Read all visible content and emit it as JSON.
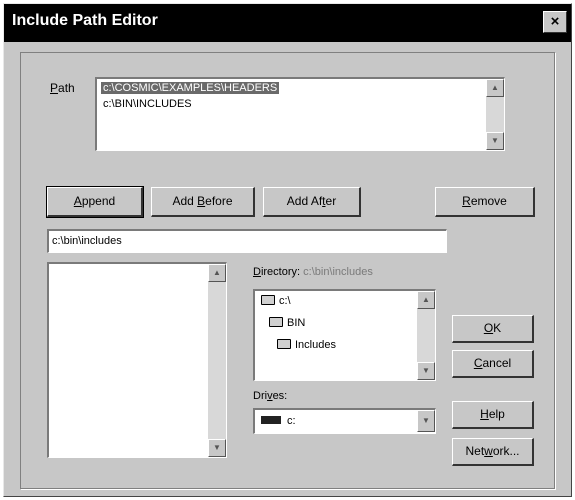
{
  "window": {
    "title": "Include Path Editor",
    "close_label": "×"
  },
  "path": {
    "label_accel": "P",
    "label_rest": "ath",
    "items": [
      "c:\\COSMIC\\EXAMPLES\\HEADERS",
      "c:\\BIN\\INCLUDES"
    ],
    "selected_index": 0
  },
  "buttons": {
    "append_accel": "A",
    "append_rest": "ppend",
    "add_before_pre": "Add ",
    "add_before_accel": "B",
    "add_before_rest": "efore",
    "add_after_pre": "Add Af",
    "add_after_accel": "t",
    "add_after_rest": "er",
    "remove_accel": "R",
    "remove_rest": "emove",
    "ok_accel": "O",
    "ok_rest": "K",
    "cancel_accel": "C",
    "cancel_rest": "ancel",
    "help_accel": "H",
    "help_rest": "elp",
    "network_pre": "Net",
    "network_accel": "w",
    "network_rest": "ork..."
  },
  "path_input": {
    "value": "c:\\bin\\includes"
  },
  "directory": {
    "label_accel": "D",
    "label_rest": "irectory:",
    "current": "c:\\bin\\includes",
    "tree": [
      "c:\\",
      "BIN",
      "Includes"
    ]
  },
  "drives": {
    "label_pre": "Dri",
    "label_accel": "v",
    "label_rest": "es:",
    "value": "c:"
  },
  "icons": {
    "scroll_up": "▲",
    "scroll_down": "▼",
    "dropdown": "▼"
  }
}
